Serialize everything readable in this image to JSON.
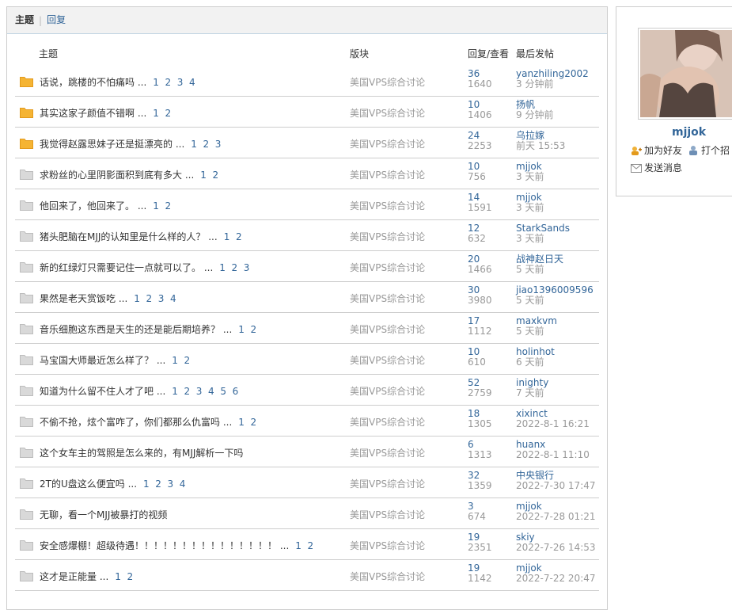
{
  "tabs": {
    "active": "主题",
    "other": "回复"
  },
  "headers": {
    "topic": "主题",
    "board": "版块",
    "stats": "回复/查看",
    "last": "最后发帖"
  },
  "colors": {
    "link": "#336699",
    "muted": "#999999",
    "folder_hot": "#f5b433",
    "folder_normal": "#d9d9d9"
  },
  "rows": [
    {
      "icon": "hot-folder-icon",
      "title": "话说，跳楼的不怕痛吗 ...",
      "pages": "1  2  3  4",
      "board": "美国VPS综合讨论",
      "replies": "36",
      "views": "1640",
      "user": "yanzhiling2002",
      "time": "3 分钟前"
    },
    {
      "icon": "hot-folder-icon",
      "title": "其实这家子颜值不错啊 ...",
      "pages": "1  2",
      "board": "美国VPS综合讨论",
      "replies": "10",
      "views": "1406",
      "user": "扬帆",
      "time": "9 分钟前"
    },
    {
      "icon": "hot-folder-icon",
      "title": "我觉得赵露思妹子还是挺漂亮的 ...",
      "pages": "1  2  3",
      "board": "美国VPS综合讨论",
      "replies": "24",
      "views": "2253",
      "user": "乌拉嫁",
      "time": "前天 15:53"
    },
    {
      "icon": "folder-icon",
      "title": "求粉丝的心里阴影面积到底有多大 ...",
      "pages": "1  2",
      "board": "美国VPS综合讨论",
      "replies": "10",
      "views": "756",
      "user": "mjjok",
      "time": "3 天前"
    },
    {
      "icon": "folder-icon",
      "title": "他回来了，他回来了。 ...",
      "pages": "1  2",
      "board": "美国VPS综合讨论",
      "replies": "14",
      "views": "1591",
      "user": "mjjok",
      "time": "3 天前"
    },
    {
      "icon": "folder-icon",
      "title": "猪头肥脑在MJJ的认知里是什么样的人？ ...",
      "pages": "1  2",
      "board": "美国VPS综合讨论",
      "replies": "12",
      "views": "632",
      "user": "StarkSands",
      "time": "3 天前"
    },
    {
      "icon": "folder-icon",
      "title": "新的红绿灯只需要记住一点就可以了。 ...",
      "pages": "1  2  3",
      "board": "美国VPS综合讨论",
      "replies": "20",
      "views": "1466",
      "user": "战神赵日天",
      "time": "5 天前"
    },
    {
      "icon": "folder-icon",
      "title": "果然是老天赏饭吃 ...",
      "pages": "1  2  3  4",
      "board": "美国VPS综合讨论",
      "replies": "30",
      "views": "3980",
      "user": "jiao1396009596",
      "time": "5 天前"
    },
    {
      "icon": "folder-icon",
      "title": "音乐细胞这东西是天生的还是能后期培养？ ...",
      "pages": "1  2",
      "board": "美国VPS综合讨论",
      "replies": "17",
      "views": "1112",
      "user": "maxkvm",
      "time": "5 天前"
    },
    {
      "icon": "folder-icon",
      "title": "马宝国大师最近怎么样了？ ...",
      "pages": "1  2",
      "board": "美国VPS综合讨论",
      "replies": "10",
      "views": "610",
      "user": "holinhot",
      "time": "6 天前"
    },
    {
      "icon": "folder-icon",
      "title": "知道为什么留不住人才了吧 ...",
      "pages": "1  2  3  4  5  6",
      "board": "美国VPS综合讨论",
      "replies": "52",
      "views": "2759",
      "user": "inighty",
      "time": "7 天前"
    },
    {
      "icon": "folder-icon",
      "title": "不偷不抢，炫个富咋了，你们都那么仇富吗 ...",
      "pages": "1  2",
      "board": "美国VPS综合讨论",
      "replies": "18",
      "views": "1305",
      "user": "xixinct",
      "time": "2022-8-1 16:21"
    },
    {
      "icon": "folder-icon",
      "title": "这个女车主的驾照是怎么来的，有MJJ解析一下吗",
      "pages": "",
      "board": "美国VPS综合讨论",
      "replies": "6",
      "views": "1313",
      "user": "huanx",
      "time": "2022-8-1 11:10"
    },
    {
      "icon": "folder-icon",
      "title": "2T的U盘这么便宜吗 ...",
      "pages": "1  2  3  4",
      "board": "美国VPS综合讨论",
      "replies": "32",
      "views": "1359",
      "user": "中央银行",
      "time": "2022-7-30 17:47"
    },
    {
      "icon": "folder-icon",
      "title": "无聊，看一个MJJ被暴打的视频",
      "pages": "",
      "board": "美国VPS综合讨论",
      "replies": "3",
      "views": "674",
      "user": "mjjok",
      "time": "2022-7-28 01:21"
    },
    {
      "icon": "folder-icon",
      "title": "安全感爆棚！超级待遇！！！！！！！！！！！！！！！ ...",
      "pages": "1  2",
      "board": "美国VPS综合讨论",
      "replies": "19",
      "views": "2351",
      "user": "skiy",
      "time": "2022-7-26 14:53"
    },
    {
      "icon": "folder-icon",
      "title": "这才是正能量 ...",
      "pages": "1  2",
      "board": "美国VPS综合讨论",
      "replies": "19",
      "views": "1142",
      "user": "mjjok",
      "time": "2022-7-22 20:47"
    }
  ],
  "profile": {
    "username": "mjjok",
    "add_friend": "加为好友",
    "greet": "打个招",
    "message": "发送消息"
  }
}
